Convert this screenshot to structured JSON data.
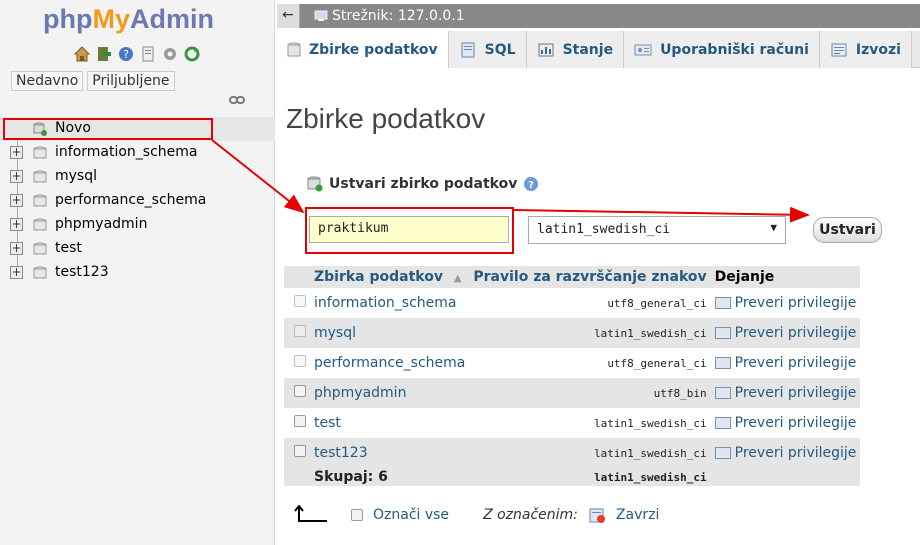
{
  "nav": {
    "logo": {
      "php": "php",
      "my": "My",
      "admin": "Admin"
    },
    "tabs": [
      "Nedavno",
      "Priljubljene"
    ],
    "tree": [
      {
        "label": "Novo",
        "kind": "new"
      },
      {
        "label": "information_schema"
      },
      {
        "label": "mysql"
      },
      {
        "label": "performance_schema"
      },
      {
        "label": "phpmyadmin"
      },
      {
        "label": "test"
      },
      {
        "label": "test123"
      }
    ]
  },
  "topbar": {
    "back": "←",
    "server": "Strežnik: 127.0.0.1"
  },
  "tabs": [
    {
      "label": "Zbirke podatkov",
      "icon": "database-icon",
      "active": true
    },
    {
      "label": "SQL",
      "icon": "sql-icon"
    },
    {
      "label": "Stanje",
      "icon": "status-icon"
    },
    {
      "label": "Uporabniški računi",
      "icon": "users-icon"
    },
    {
      "label": "Izvozi",
      "icon": "export-icon"
    }
  ],
  "page": {
    "title": "Zbirke podatkov",
    "create_heading": "Ustvari zbirko podatkov",
    "db_name_value": "praktikum",
    "collation_value": "latin1_swedish_ci",
    "create_button": "Ustvari"
  },
  "table": {
    "headers": {
      "db": "Zbirka podatkov",
      "sort": "▲",
      "collation": "Pravilo za razvrščanje znakov",
      "action": "Dejanje"
    },
    "rows": [
      {
        "db": "information_schema",
        "collation": "utf8_general_ci",
        "action": "Preveri privilegije",
        "disabled": true
      },
      {
        "db": "mysql",
        "collation": "latin1_swedish_ci",
        "action": "Preveri privilegije",
        "disabled": true
      },
      {
        "db": "performance_schema",
        "collation": "utf8_general_ci",
        "action": "Preveri privilegije",
        "disabled": true
      },
      {
        "db": "phpmyadmin",
        "collation": "utf8_bin",
        "action": "Preveri privilegije",
        "disabled": false
      },
      {
        "db": "test",
        "collation": "latin1_swedish_ci",
        "action": "Preveri privilegije",
        "disabled": false
      },
      {
        "db": "test123",
        "collation": "latin1_swedish_ci",
        "action": "Preveri privilegije",
        "disabled": false
      }
    ],
    "total_label": "Skupaj: 6",
    "total_collation": "latin1_swedish_ci"
  },
  "footer": {
    "select_all": "Označi vse",
    "with_selected": "Z označenim:",
    "drop": "Zavrzi"
  },
  "colors": {
    "link": "#235a81",
    "annotation": "#e60000",
    "input_bg": "#ffffcc"
  }
}
